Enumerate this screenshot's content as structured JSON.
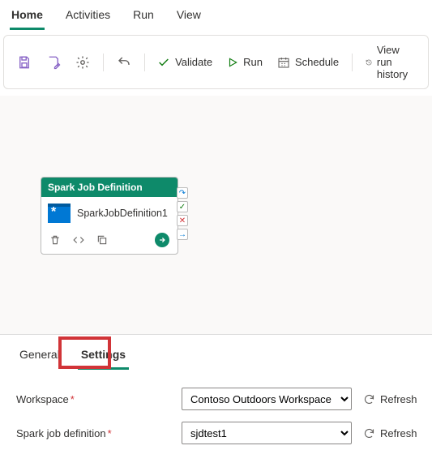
{
  "menu": {
    "tabs": [
      "Home",
      "Activities",
      "Run",
      "View"
    ],
    "active": 0
  },
  "toolbar": {
    "validate": "Validate",
    "run": "Run",
    "schedule": "Schedule",
    "view_run_history": "View run history"
  },
  "node": {
    "type_label": "Spark Job Definition",
    "title": "SparkJobDefinition1"
  },
  "badges": {
    "skip": "↷",
    "success": "✓",
    "fail": "✕",
    "next": "→"
  },
  "panel": {
    "tabs": [
      "General",
      "Settings"
    ],
    "active": 1
  },
  "form": {
    "workspace": {
      "label": "Workspace",
      "value": "Contoso Outdoors Workspace",
      "refresh": "Refresh"
    },
    "sjd": {
      "label": "Spark job definition",
      "value": "sjdtest1",
      "refresh": "Refresh"
    }
  }
}
